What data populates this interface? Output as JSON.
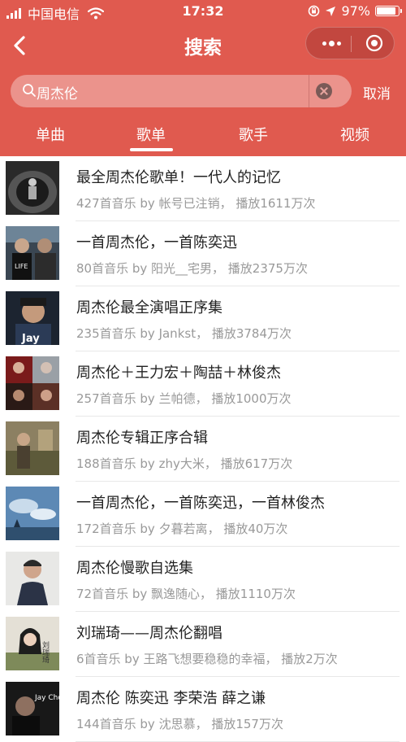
{
  "status_bar": {
    "carrier": "中国电信",
    "time": "17:32",
    "battery_percent": "97%",
    "battery_level": 0.97
  },
  "nav": {
    "title": "搜索",
    "back_icon": "chevron-left-icon",
    "more_icon": "more-dots-icon",
    "close_icon": "target-circle-icon"
  },
  "search": {
    "value": "周杰伦",
    "cancel_label": "取消"
  },
  "tabs": [
    {
      "label": "单曲",
      "active": false
    },
    {
      "label": "歌单",
      "active": true
    },
    {
      "label": "歌手",
      "active": false
    },
    {
      "label": "视频",
      "active": false
    }
  ],
  "playlists": [
    {
      "title": "最全周杰伦歌单！一代人的记忆",
      "meta": "427首音乐 by 帐号已注销，  播放1611万次",
      "cover_overlay": ""
    },
    {
      "title": "一首周杰伦，一首陈奕迅",
      "meta": "80首音乐 by 阳光__宅男，  播放2375万次",
      "cover_overlay": "LIFE"
    },
    {
      "title": "周杰伦最全演唱正序集",
      "meta": "235首音乐 by Jankst，  播放3784万次",
      "cover_overlay": "Jay"
    },
    {
      "title": "周杰伦＋王力宏＋陶喆＋林俊杰",
      "meta": "257首音乐 by 兰帕德，  播放1000万次",
      "cover_overlay": ""
    },
    {
      "title": "周杰伦专辑正序合辑",
      "meta": "188首音乐 by zhy大米，  播放617万次",
      "cover_overlay": ""
    },
    {
      "title": "一首周杰伦，一首陈奕迅，一首林俊杰",
      "meta": "172首音乐 by 夕暮若离，  播放40万次",
      "cover_overlay": ""
    },
    {
      "title": "周杰伦慢歌自选集",
      "meta": "72首音乐 by 飘逸随心，  播放1110万次",
      "cover_overlay": ""
    },
    {
      "title": "刘瑞琦——周杰伦翻唱",
      "meta": "6首音乐 by 王路飞想要稳稳的幸福，  播放2万次",
      "cover_overlay": "刘瑞琦"
    },
    {
      "title": "周杰伦 陈奕迅 李荣浩 薛之谦",
      "meta": "144首音乐 by 沈思慕，  播放157万次",
      "cover_overlay": "Jay Chou"
    }
  ],
  "colors": {
    "header_bg": "#e05a4f",
    "title_text": "#222222",
    "meta_text": "#999999"
  }
}
